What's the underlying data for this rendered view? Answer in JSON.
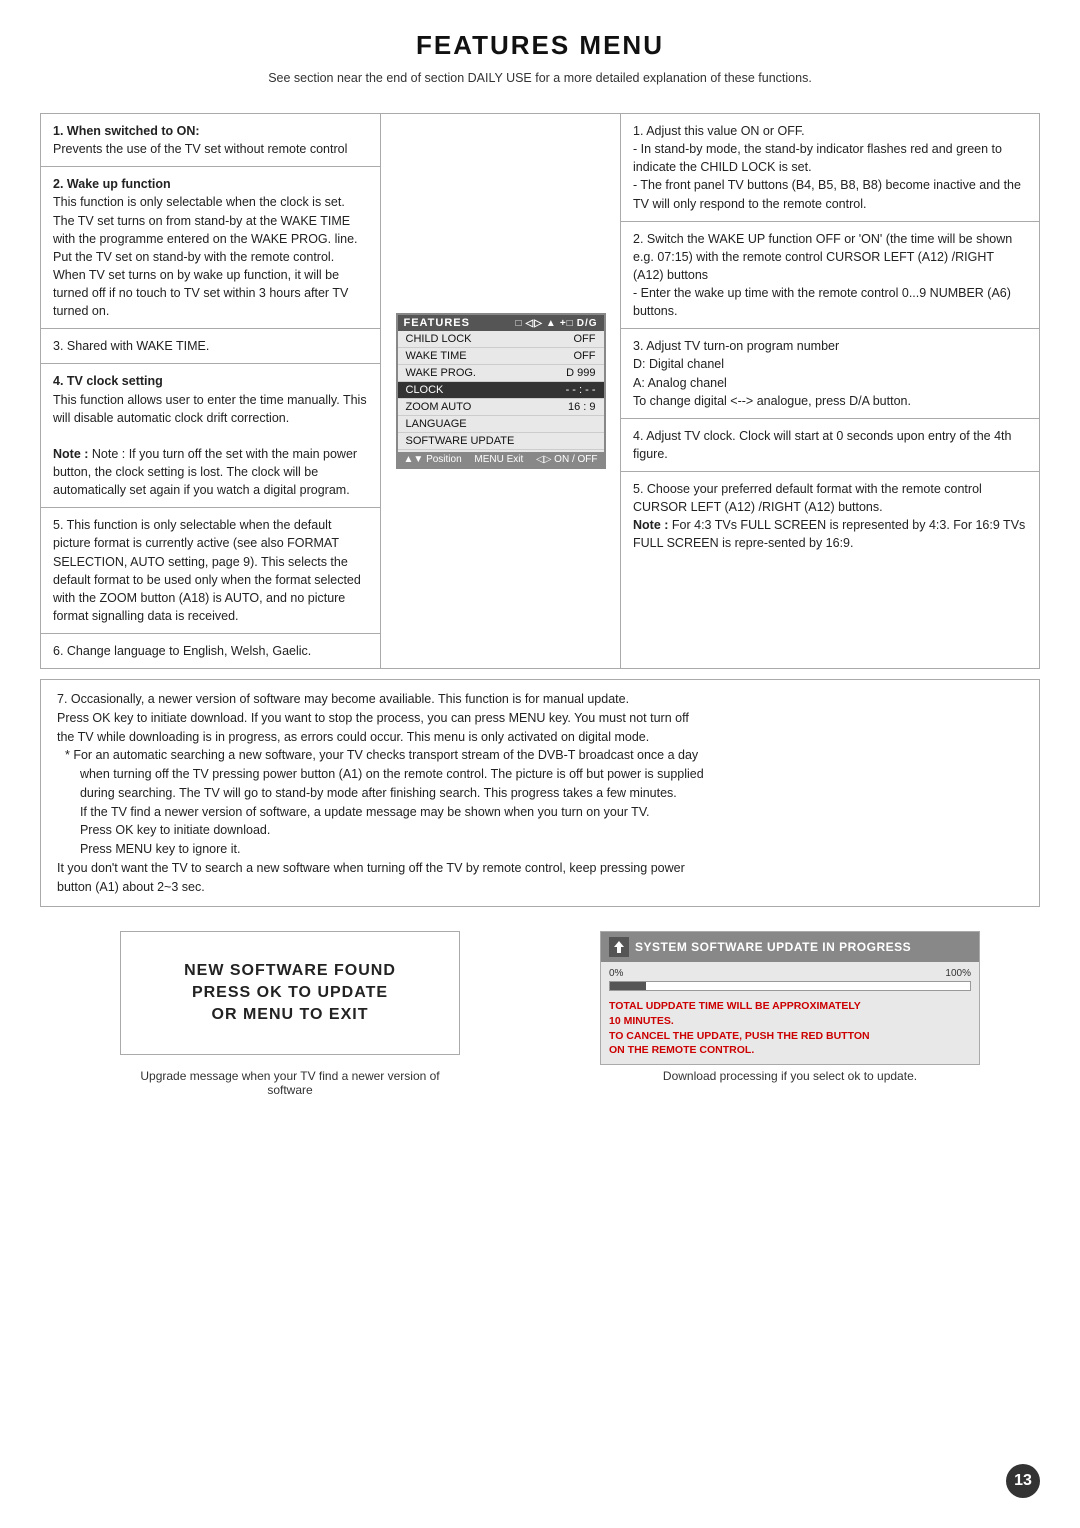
{
  "page": {
    "title": "FEATURES MENU",
    "subtitle": "See section near the end of section DAILY USE for a more detailed explanation of these functions.",
    "page_number": "13"
  },
  "left_items": [
    {
      "id": "item1",
      "number": "1.",
      "title": "When switched to ON:",
      "body": "Prevents the use of the TV set without remote control"
    },
    {
      "id": "item2",
      "number": "2.",
      "title": "Wake up function",
      "body": "This function is only selectable when the clock is set. The TV set turns on from stand-by at the WAKE TIME with the programme entered on the WAKE PROG. line. Put the TV set on stand-by with the remote control. When TV set turns on by wake up function, it will be turned off if no touch to TV set within 3 hours after TV turned on."
    },
    {
      "id": "item3",
      "number": "3.",
      "title": "",
      "body": "Shared with WAKE TIME."
    },
    {
      "id": "item4",
      "number": "4.",
      "title": "TV clock setting",
      "body": "This function allows user to enter the time manually. This will disable automatic clock drift correction.",
      "note": "Note : If you turn off the set with the main power button, the clock setting is lost. The clock will be automatically set again if you watch a digital program."
    },
    {
      "id": "item5",
      "number": "5.",
      "body": "This function is only selectable when the default picture format is currently active (see also FORMAT SELECTION, AUTO setting, page 9). This selects the default format to be used only when the format selected with the ZOOM button (A18) is AUTO, and no picture format signalling data is received."
    },
    {
      "id": "item6",
      "number": "6.",
      "body": "Change language to English, Welsh, Gaelic."
    }
  ],
  "tv_screen": {
    "header_label": "FEATURES",
    "header_icons": [
      "□",
      "◁▷",
      "▲",
      "+□",
      "D/G"
    ],
    "rows": [
      {
        "label": "CHILD LOCK",
        "value": "OFF",
        "selected": false
      },
      {
        "label": "WAKE TIME",
        "value": "OFF",
        "selected": false
      },
      {
        "label": "WAKE PROG.",
        "value": "",
        "selected": false
      },
      {
        "label": "CLOCK",
        "value": "- - : - -",
        "selected": true
      },
      {
        "label": "ZOOM AUTO",
        "value": "16 : 9",
        "selected": false
      },
      {
        "label": "LANGUAGE",
        "value": "",
        "selected": false
      },
      {
        "label": "SOFTWARE UPDATE",
        "value": "",
        "selected": false
      }
    ],
    "footer_left": "▲▼ Position",
    "footer_right": "◁▷ ON / OFF",
    "footer_menu": "MENU Exit"
  },
  "right_items": [
    {
      "id": "r1",
      "number": "1.",
      "body": "Adjust this value ON or OFF.\n- In stand-by mode, the stand-by indicator flashes red and green to indicate the CHILD LOCK is set.\n- The front panel TV buttons (B4, B5, B8, B8) become inactive and the TV will only respond to the remote control."
    },
    {
      "id": "r2",
      "number": "2.",
      "body": "Switch the WAKE UP function OFF or 'ON' (the time will be shown e.g. 07:15) with the remote control CURSOR LEFT (A12) /RIGHT (A12) buttons\n- Enter the wake up time with the remote control 0...9 NUMBER (A6) buttons."
    },
    {
      "id": "r3",
      "number": "3.",
      "body": "Adjust TV turn-on program number\nD: Digital chanel\nA: Analog chanel\nTo change digital <--> analogue, press D/A button."
    },
    {
      "id": "r4",
      "number": "4.",
      "body": "Adjust TV clock. Clock will start at 0 seconds upon entry of the 4th figure."
    },
    {
      "id": "r5",
      "number": "5.",
      "body": "Choose your preferred default format with the remote control CURSOR LEFT (A12) /RIGHT (A12) buttons.\nNote : For 4:3 TVs FULL SCREEN is represented by 4:3. For 16:9 TVs FULL SCREEN is represented by 16:9."
    }
  ],
  "bottom_text": {
    "number": "7.",
    "lines": [
      "Occasionally, a newer version of software may become availiable. This function is for manual update.",
      "Press OK key to initiate download. If you want to stop the process, you can press MENU key. You must not turn off",
      "the TV while downloading is in progress, as errors could occur. This menu is only activated on digital mode.",
      "* For an automatic searching a new software, your TV checks transport stream of the DVB-T broadcast once a day",
      "  when turning off the TV pressing power button (A1) on the remote control. The picture is off but power is supplied",
      "  during searching. The TV will go to stand-by mode after finishing search. This progress takes a few minutes.",
      "  If the TV find a newer version of software, a update message may be shown when you turn on your TV.",
      "  Press OK key to initiate download.",
      "  Press MENU key to ignore it.",
      "It you don't want the TV to search a new software when turning off the TV by remote control, keep pressing power",
      "button (A1) about 2~3 sec."
    ]
  },
  "new_software_box": {
    "line1": "NEW SOFTWARE FOUND",
    "line2": "PRESS OK TO UPDATE",
    "line3": "OR MENU TO EXIT",
    "caption": "Upgrade message when your TV find a newer version of software"
  },
  "progress_box": {
    "header": "SYSTEM SOFTWARE UPDATE IN PROGRESS",
    "bar_start": "0%",
    "bar_end": "100%",
    "bar_fill_pct": 10,
    "messages": [
      "TOTAL UDPDATE TIME WILL BE APPROXIMATELY",
      "10 MINUTES.",
      "TO CANCEL THE UPDATE, PUSH THE RED BUTTON",
      "ON THE REMOTE CONTROL."
    ],
    "caption": "Download processing if you select ok to update."
  }
}
